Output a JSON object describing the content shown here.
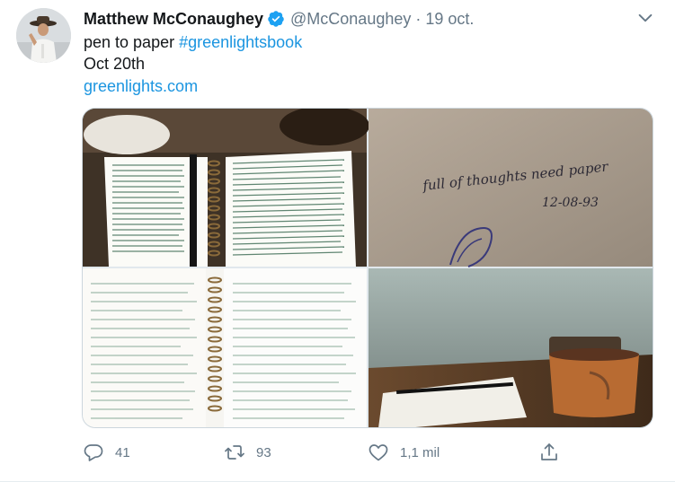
{
  "tweet": {
    "display_name": "Matthew McConaughey",
    "handle": "@McConaughey",
    "separator": "·",
    "date": "19 oct.",
    "text_prefix": "pen to paper ",
    "hashtag": "#greenlightsbook",
    "line2": "Oct 20th",
    "link": "greenlights.com",
    "notebook_inscription": "full of thoughts need paper",
    "notebook_date": "12-08-93"
  },
  "actions": {
    "reply_count": "41",
    "retweet_count": "93",
    "like_count": "1,1 mil"
  },
  "colors": {
    "accent": "#1b95e0",
    "muted": "#657786",
    "border": "#e6ecf0"
  },
  "icons": [
    "verified-badge-icon",
    "chevron-down-icon",
    "reply-icon",
    "retweet-icon",
    "like-icon",
    "share-icon"
  ]
}
